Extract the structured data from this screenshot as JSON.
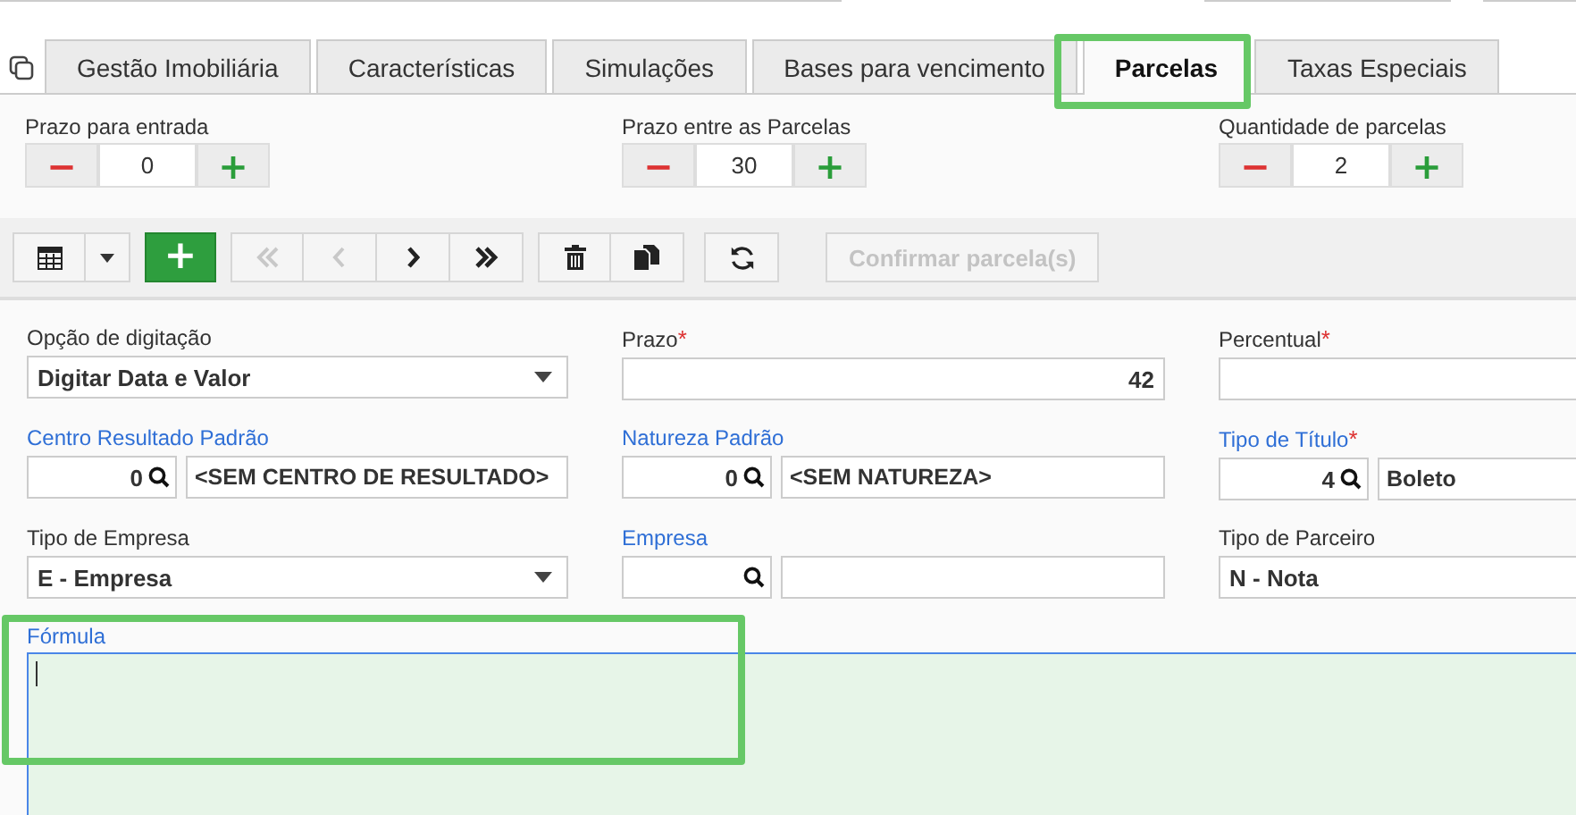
{
  "tabs": [
    {
      "label": "Gestão Imobiliária",
      "selected": false
    },
    {
      "label": "Características",
      "selected": false
    },
    {
      "label": "Simulações",
      "selected": false
    },
    {
      "label": "Bases para vencimento",
      "selected": false
    },
    {
      "label": "Parcelas",
      "selected": true
    },
    {
      "label": "Taxas Especiais",
      "selected": false
    }
  ],
  "steppers": [
    {
      "label": "Prazo para entrada",
      "minus": "−",
      "value": "0",
      "plus": "+"
    },
    {
      "label": "Prazo entre as Parcelas",
      "minus": "−",
      "value": "30",
      "plus": "+"
    },
    {
      "label": "Quantidade de parcelas",
      "minus": "−",
      "value": "2",
      "plus": "+"
    }
  ],
  "toolbar": {
    "add": "+",
    "first": {
      "disabled": true
    },
    "previous": {
      "disabled": true
    },
    "next": {
      "disabled": false
    },
    "last": {
      "disabled": false
    },
    "confirm": {
      "label": "Confirmar parcela(s)",
      "disabled": true
    }
  },
  "fields": [
    {
      "kind": "select",
      "label": "Opção de digitação",
      "linked": false,
      "value": "Digitar Data e Valor"
    },
    {
      "kind": "text",
      "label": "Prazo",
      "linked": false,
      "required_mark": "*",
      "value": "42"
    },
    {
      "kind": "text",
      "label": "Percentual",
      "linked": false,
      "required_mark": "*"
    },
    {
      "kind": "lookup",
      "label": "Centro Resultado Padrão",
      "linked": true,
      "code": "0",
      "description": "<SEM CENTRO DE RESULTADO>"
    },
    {
      "kind": "lookup",
      "label": "Natureza Padrão",
      "linked": true,
      "code": "0",
      "description": "<SEM NATUREZA>"
    },
    {
      "kind": "lookup",
      "label": "Tipo de Título",
      "linked": true,
      "required_mark": "*",
      "code": "4",
      "description": "Boleto"
    },
    {
      "kind": "select",
      "label": "Tipo de Empresa",
      "linked": false,
      "value": "E - Empresa"
    },
    {
      "kind": "lookup",
      "label": "Empresa",
      "linked": true
    },
    {
      "kind": "text",
      "label": "Tipo de Parceiro",
      "linked": false,
      "value": "N - Nota"
    }
  ],
  "formula": {
    "label": "Fórmula",
    "linked": true
  }
}
